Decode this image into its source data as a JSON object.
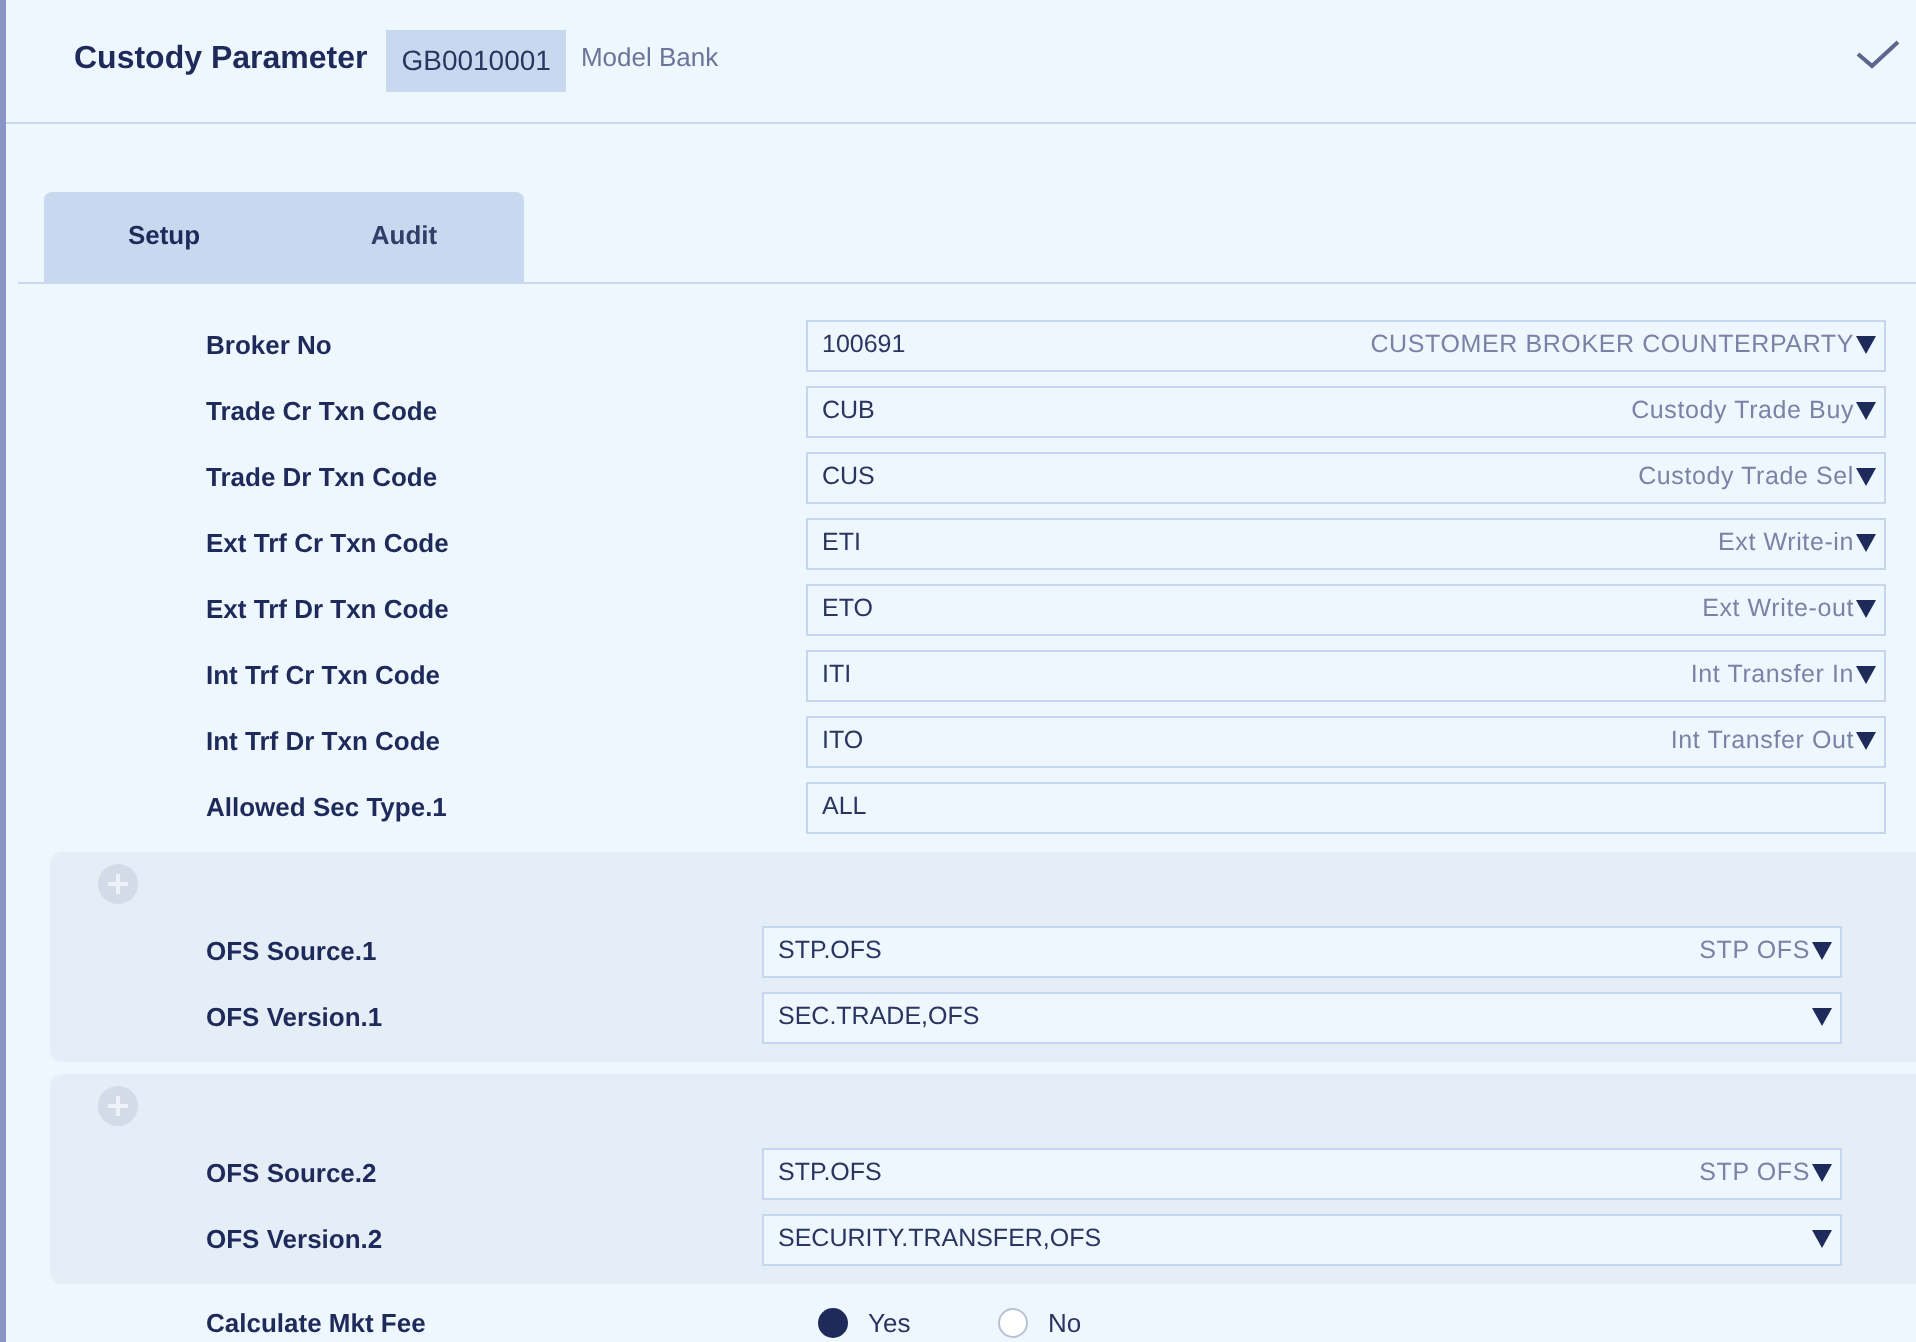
{
  "header": {
    "title": "Custody Parameter",
    "record_id": "GB0010001",
    "company": "Model Bank"
  },
  "tabs": [
    {
      "label": "Setup",
      "selected": true
    },
    {
      "label": "Audit",
      "selected": false
    }
  ],
  "fields": [
    {
      "label": "Broker No",
      "kind": "select",
      "value": "100691",
      "description": "CUSTOMER BROKER COUNTERPARTY"
    },
    {
      "label": "Trade Cr Txn Code",
      "kind": "select",
      "value": "CUB",
      "description": "Custody Trade Buy"
    },
    {
      "label": "Trade Dr Txn Code",
      "kind": "select",
      "value": "CUS",
      "description": "Custody Trade Sel"
    },
    {
      "label": "Ext Trf Cr Txn Code",
      "kind": "select",
      "value": "ETI",
      "description": "Ext Write-in"
    },
    {
      "label": "Ext Trf Dr Txn Code",
      "kind": "select",
      "value": "ETO",
      "description": "Ext Write-out"
    },
    {
      "label": "Int Trf Cr Txn Code",
      "kind": "select",
      "value": "ITI",
      "description": "Int Transfer In"
    },
    {
      "label": "Int Trf Dr Txn Code",
      "kind": "select",
      "value": "ITO",
      "description": "Int Transfer Out"
    },
    {
      "label": "Allowed Sec Type.1",
      "kind": "input",
      "value": "ALL"
    }
  ],
  "groups": [
    {
      "fields": [
        {
          "label": "OFS Source.1",
          "kind": "select",
          "value": "STP.OFS",
          "description": "STP OFS"
        },
        {
          "label": "OFS Version.1",
          "kind": "select",
          "value": "SEC.TRADE,OFS"
        }
      ]
    },
    {
      "fields": [
        {
          "label": "OFS Source.2",
          "kind": "select",
          "value": "STP.OFS",
          "description": "STP OFS"
        },
        {
          "label": "OFS Version.2",
          "kind": "select",
          "value": "SECURITY.TRANSFER,OFS"
        }
      ]
    }
  ],
  "radio_field": {
    "label": "Calculate Mkt Fee",
    "options": [
      {
        "label": "Yes",
        "selected": true
      },
      {
        "label": "No",
        "selected": false
      }
    ]
  }
}
